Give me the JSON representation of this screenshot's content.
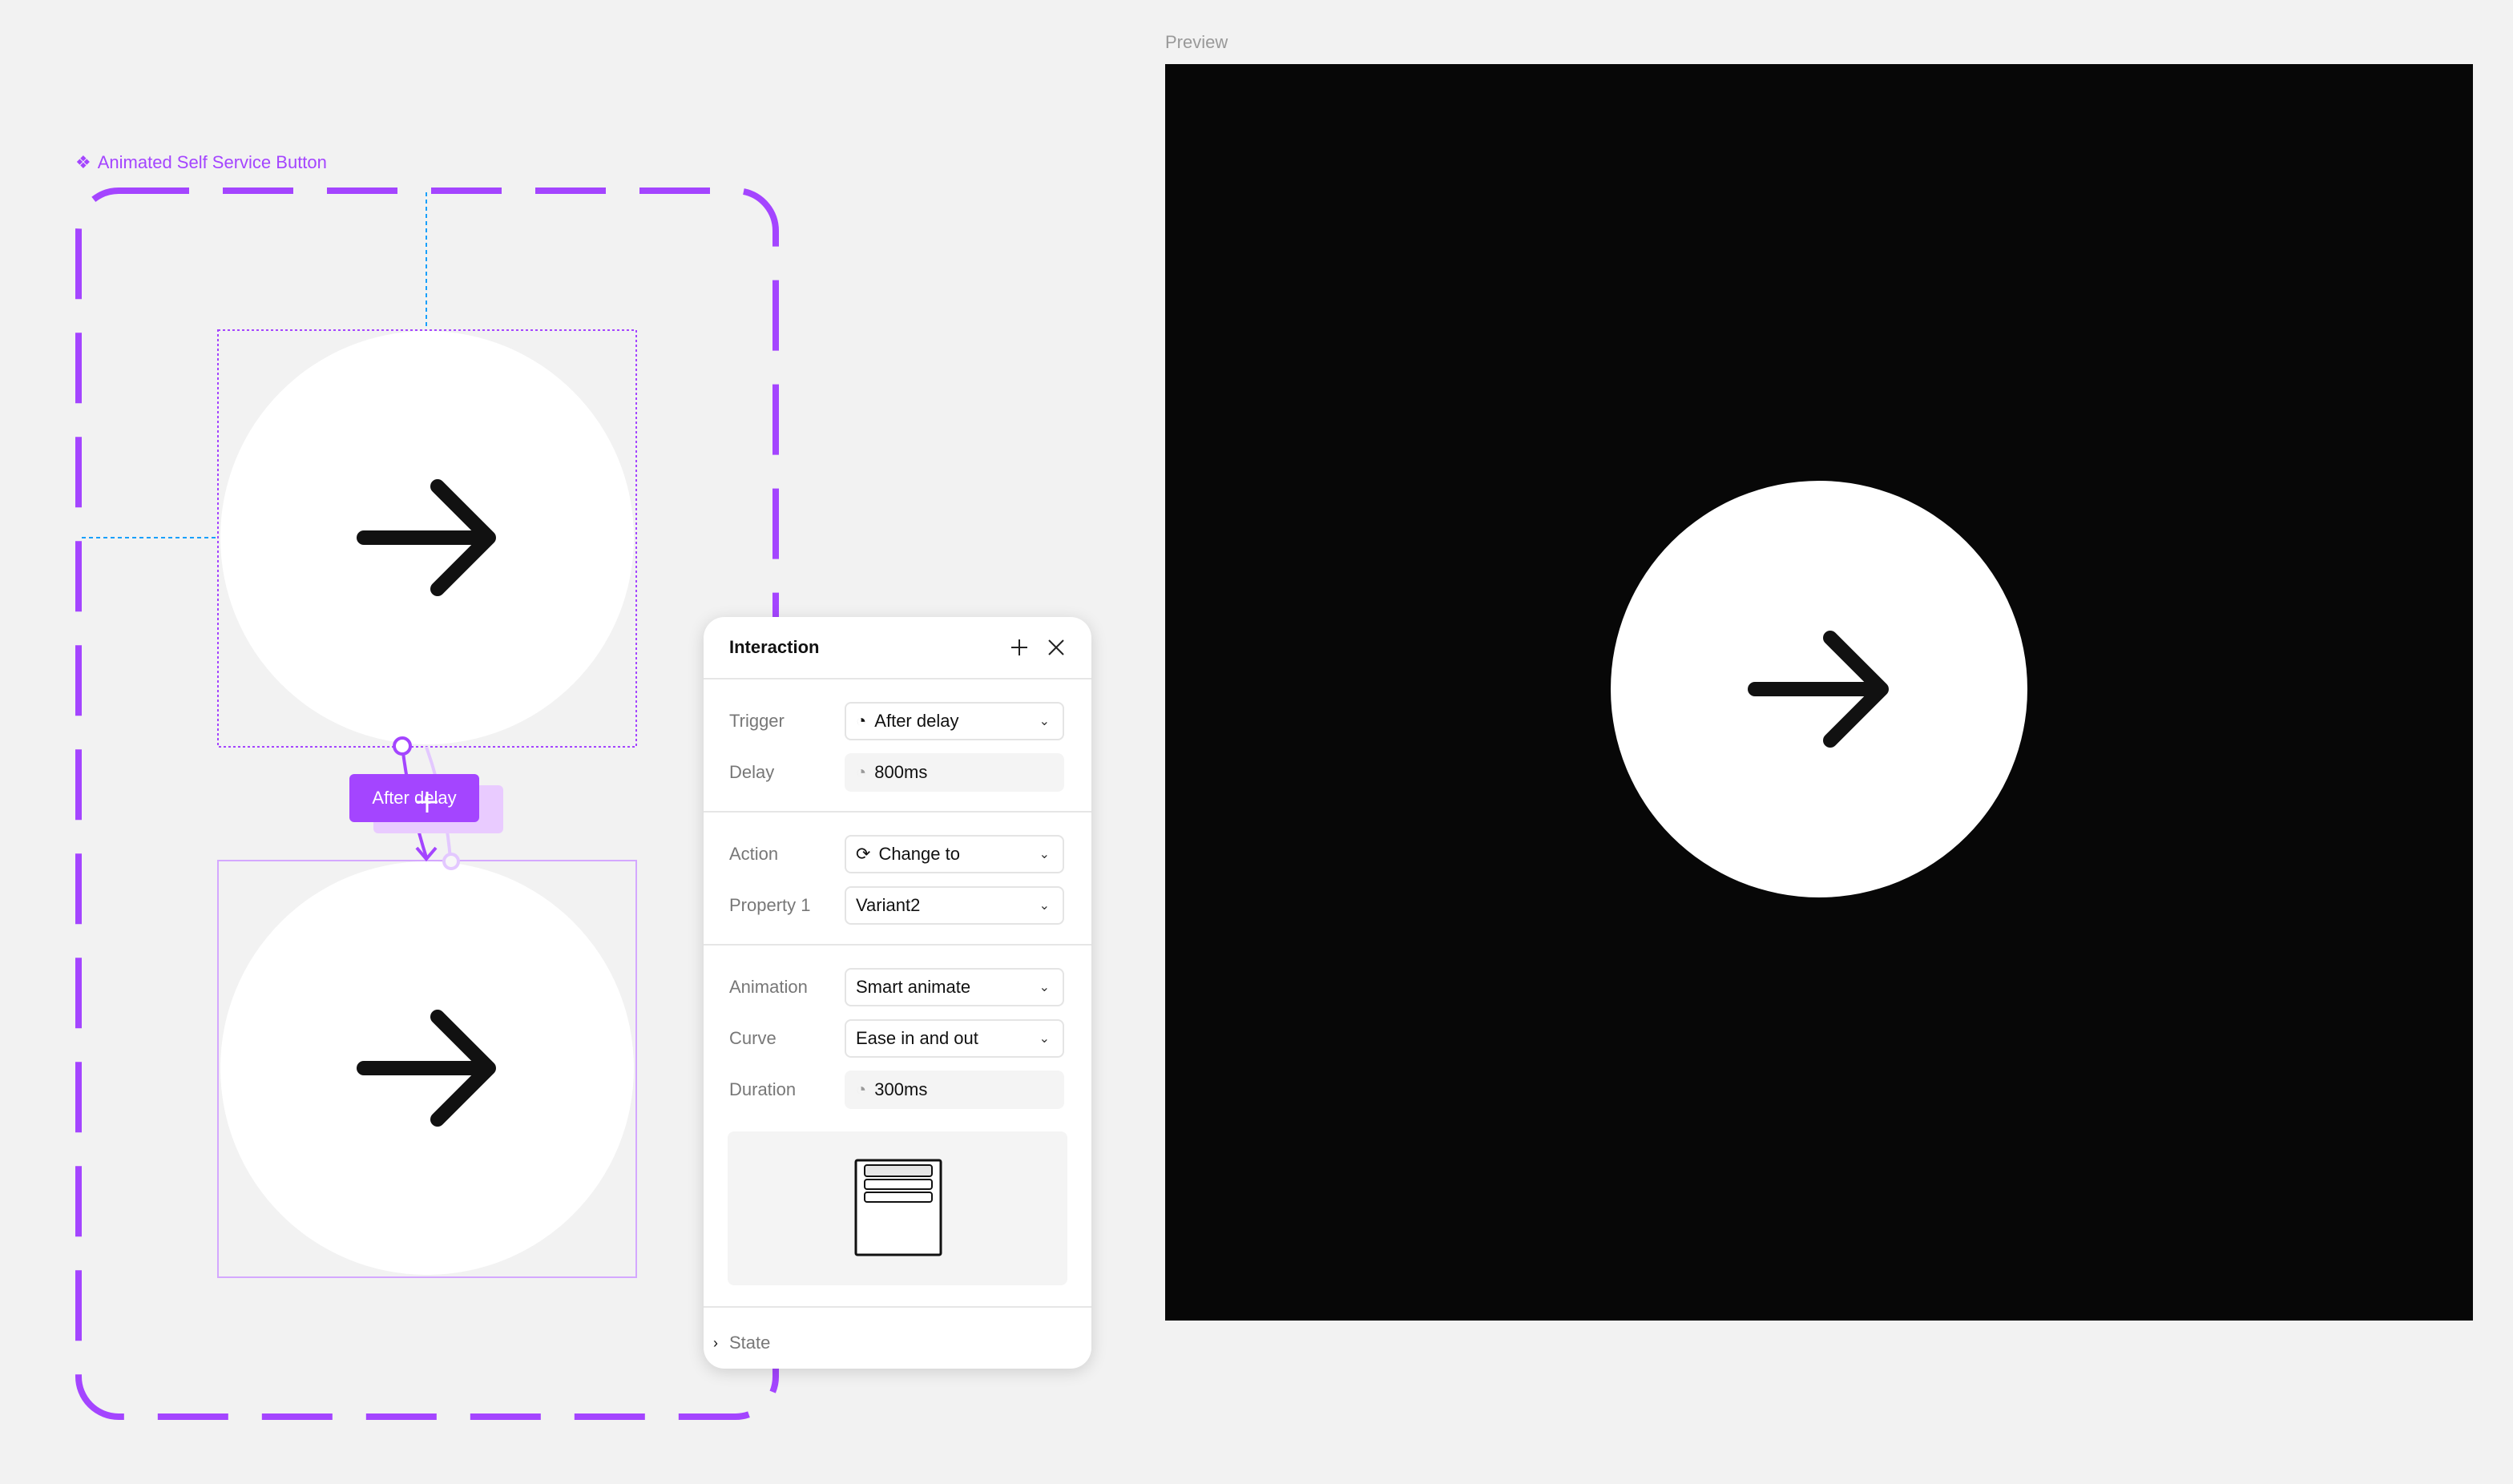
{
  "component": {
    "name": "Animated Self Service Button",
    "icon": "component-icon"
  },
  "flow": {
    "label": "After delay"
  },
  "interaction_panel": {
    "title": "Interaction",
    "add_icon": "plus-icon",
    "close_icon": "close-icon",
    "trigger": {
      "label": "Trigger",
      "value": "After delay",
      "icon": "timer-icon"
    },
    "delay": {
      "label": "Delay",
      "value": "800ms",
      "icon": "timer-icon"
    },
    "action": {
      "label": "Action",
      "value": "Change to",
      "icon": "refresh-icon"
    },
    "property": {
      "label": "Property 1",
      "value": "Variant2"
    },
    "animation": {
      "label": "Animation",
      "value": "Smart animate"
    },
    "curve": {
      "label": "Curve",
      "value": "Ease in and out"
    },
    "duration": {
      "label": "Duration",
      "value": "300ms",
      "icon": "timer-icon"
    },
    "state": {
      "label": "State"
    }
  },
  "preview": {
    "label": "Preview",
    "background": "#070707"
  },
  "colors": {
    "accent": "#a445ff",
    "guide": "#18a0fb"
  }
}
